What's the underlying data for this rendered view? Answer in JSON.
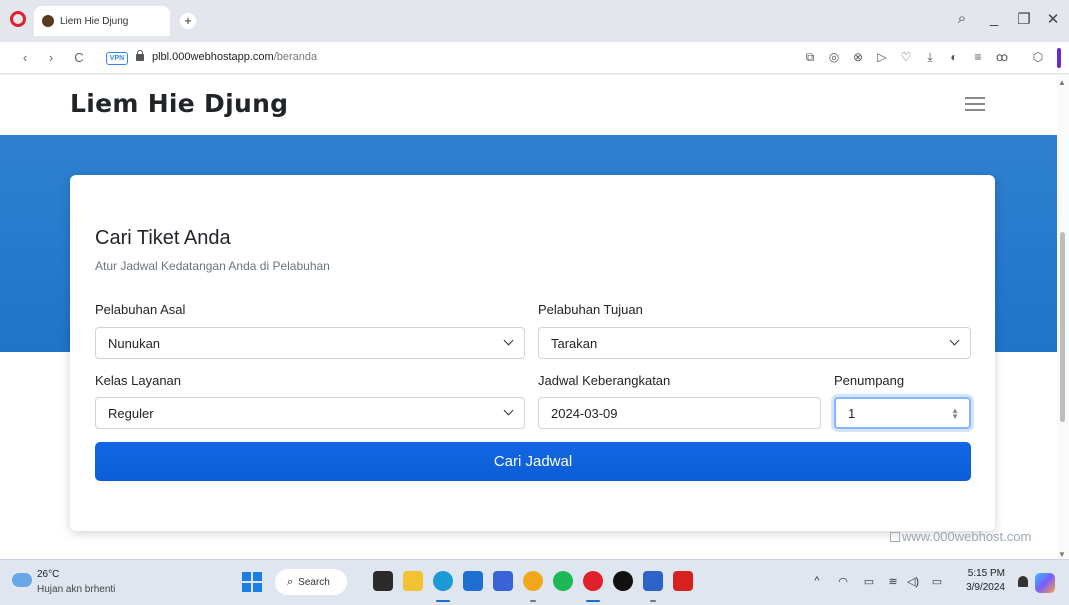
{
  "browser": {
    "tab_title": "Liem Hie Djung",
    "new_tab": "+",
    "vpn_badge": "VPN",
    "url_host": "plbl.000webhostapp.com",
    "url_path": "/beranda",
    "window_controls": {
      "search": "⌕",
      "minimize": "_",
      "restore": "❐",
      "close": "✕"
    },
    "nav": {
      "back": "‹",
      "forward": "›",
      "reload": "C"
    },
    "toolbar_icons": [
      "snapshot-icon",
      "camera-icon",
      "adblock-icon",
      "play-icon",
      "heart-icon",
      "download-icon",
      "battery-icon",
      "easy-setup-icon",
      "profile-icon",
      "extensions-icon"
    ]
  },
  "site": {
    "brand": "Liem Hie Djung",
    "card": {
      "title": "Cari Tiket Anda",
      "subtitle": "Atur Jadwal Kedatangan Anda di Pelabuhan",
      "origin_label": "Pelabuhan Asal",
      "origin_value": "Nunukan",
      "destination_label": "Pelabuhan Tujuan",
      "destination_value": "Tarakan",
      "class_label": "Kelas Layanan",
      "class_value": "Reguler",
      "date_label": "Jadwal Keberangkatan",
      "date_value": "2024-03-09",
      "passenger_label": "Penumpang",
      "passenger_value": "1",
      "search_button": "Cari Jadwal"
    },
    "host_badge": "www.000webhost.com"
  },
  "taskbar": {
    "temperature": "26°C",
    "weather": "Hujan akn brhenti",
    "search_label": "Search",
    "time": "5:15 PM",
    "date": "3/9/2024",
    "tray": {
      "chevron": "^",
      "network": "◠",
      "keyboard": "▭",
      "wifi": "≋",
      "volume": "◁)",
      "battery": "▭"
    },
    "apps": [
      {
        "name": "task-view",
        "color": "#2b2b2b"
      },
      {
        "name": "file-explorer",
        "color": "#f2c230"
      },
      {
        "name": "edge",
        "color": "#1b9ad6"
      },
      {
        "name": "store",
        "color": "#1f6fd1"
      },
      {
        "name": "visual-studio",
        "color": "#3a63d8"
      },
      {
        "name": "chrome",
        "color": "#f0a81a"
      },
      {
        "name": "spotify",
        "color": "#1db954"
      },
      {
        "name": "opera",
        "color": "#e0202a"
      },
      {
        "name": "tiktok",
        "color": "#111111"
      },
      {
        "name": "word",
        "color": "#2b63c6"
      },
      {
        "name": "acrobat",
        "color": "#d6211f"
      }
    ]
  },
  "colors": {
    "hero": "#1f74c9",
    "primary_button": "#0b5ed7",
    "focus_ring": "#86b7fe"
  }
}
